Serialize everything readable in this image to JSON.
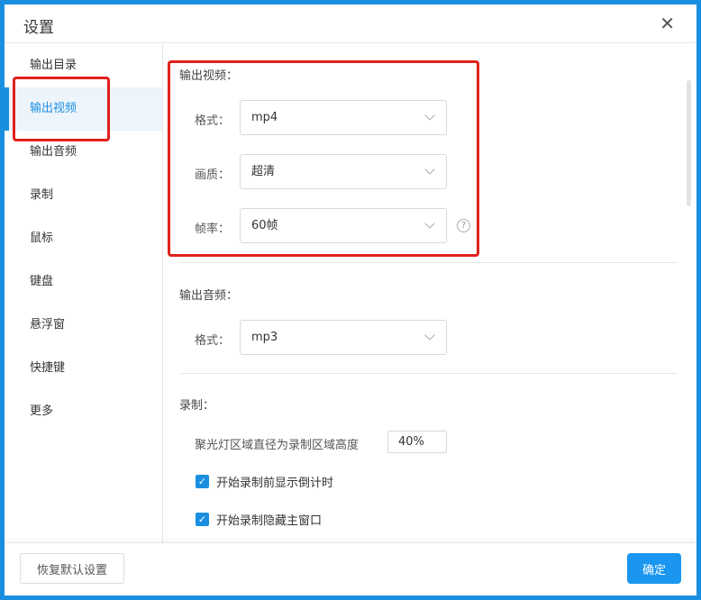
{
  "title": "设置",
  "sidebar": {
    "items": [
      {
        "label": "输出目录"
      },
      {
        "label": "输出视频"
      },
      {
        "label": "输出音频"
      },
      {
        "label": "录制"
      },
      {
        "label": "鼠标"
      },
      {
        "label": "键盘"
      },
      {
        "label": "悬浮窗"
      },
      {
        "label": "快捷键"
      },
      {
        "label": "更多"
      }
    ],
    "active": 1
  },
  "video": {
    "heading": "输出视频：",
    "format_label": "格式：",
    "format_value": "mp4",
    "quality_label": "画质：",
    "quality_value": "超清",
    "fps_label": "帧率：",
    "fps_value": "60帧"
  },
  "audio": {
    "heading": "输出音频：",
    "format_label": "格式：",
    "format_value": "mp3"
  },
  "record": {
    "heading": "录制：",
    "spotlight_label": "聚光灯区域直径为录制区域高度",
    "spotlight_value": "40%",
    "countdown_label": "开始录制前显示倒计时",
    "countdown_checked": true,
    "hide_label": "开始录制隐藏主窗口",
    "hide_checked": true
  },
  "footer": {
    "reset": "恢复默认设置",
    "ok": "确定"
  },
  "colors": {
    "accent": "#1a8fe0",
    "highlight": "#e0201c"
  }
}
